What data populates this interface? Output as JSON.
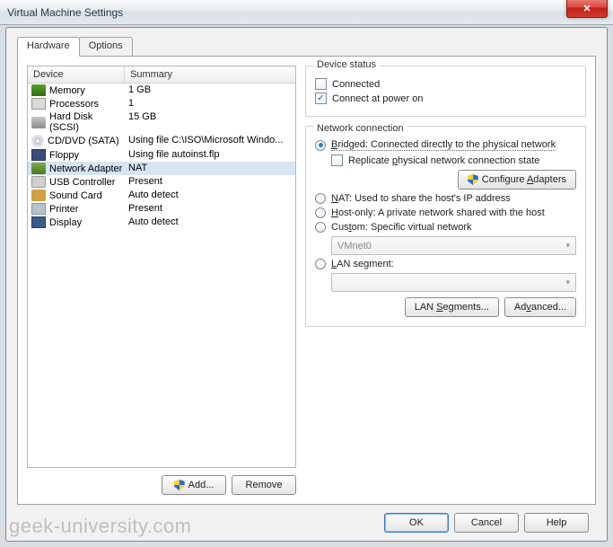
{
  "window": {
    "title": "Virtual Machine Settings",
    "close_glyph": "✕"
  },
  "tabs": {
    "hardware": "Hardware",
    "options": "Options"
  },
  "device_table": {
    "header_device": "Device",
    "header_summary": "Summary",
    "rows": [
      {
        "icon": "memory-icon",
        "name": "Memory",
        "summary": "1 GB"
      },
      {
        "icon": "cpu-icon",
        "name": "Processors",
        "summary": "1"
      },
      {
        "icon": "hd-icon",
        "name": "Hard Disk (SCSI)",
        "summary": "15 GB"
      },
      {
        "icon": "cd-icon",
        "name": "CD/DVD (SATA)",
        "summary": "Using file C:\\ISO\\Microsoft Windo..."
      },
      {
        "icon": "floppy-icon",
        "name": "Floppy",
        "summary": "Using file autoinst.flp"
      },
      {
        "icon": "net-icon",
        "name": "Network Adapter",
        "summary": "NAT"
      },
      {
        "icon": "usb-icon",
        "name": "USB Controller",
        "summary": "Present"
      },
      {
        "icon": "sound-icon",
        "name": "Sound Card",
        "summary": "Auto detect"
      },
      {
        "icon": "printer-icon",
        "name": "Printer",
        "summary": "Present"
      },
      {
        "icon": "display-icon",
        "name": "Display",
        "summary": "Auto detect"
      }
    ],
    "selected_index": 5
  },
  "left_buttons": {
    "add": "Add...",
    "remove": "Remove"
  },
  "device_status": {
    "title": "Device status",
    "connected": "Connected",
    "connected_checked": false,
    "connect_power": "Connect at power on",
    "connect_power_checked": true
  },
  "network": {
    "title": "Network connection",
    "bridged_pre": "",
    "bridged_u": "B",
    "bridged_post": "ridged: Connected directly to the physical network",
    "replicate_pre": "Replicate ",
    "replicate_u": "p",
    "replicate_post": "hysical network connection state",
    "replicate_checked": false,
    "configure_pre": "Configure ",
    "configure_u": "A",
    "configure_post": "dapters",
    "nat_u": "N",
    "nat_post": "AT: Used to share the host's IP address",
    "hostonly_pre": "",
    "hostonly_u": "H",
    "hostonly_post": "ost-only: A private network shared with the host",
    "custom_pre": "Cus",
    "custom_u": "t",
    "custom_post": "om: Specific virtual network",
    "custom_combo": "VMnet0",
    "lan_pre": "",
    "lan_u": "L",
    "lan_post": "AN segment:",
    "lan_combo": "",
    "lan_segments_btn_pre": "LAN ",
    "lan_segments_btn_u": "S",
    "lan_segments_btn_post": "egments...",
    "advanced_pre": "Ad",
    "advanced_u": "v",
    "advanced_post": "anced...",
    "selected": "bridged"
  },
  "bottom": {
    "ok": "OK",
    "cancel": "Cancel",
    "help": "Help"
  },
  "watermark": "geek-university.com"
}
